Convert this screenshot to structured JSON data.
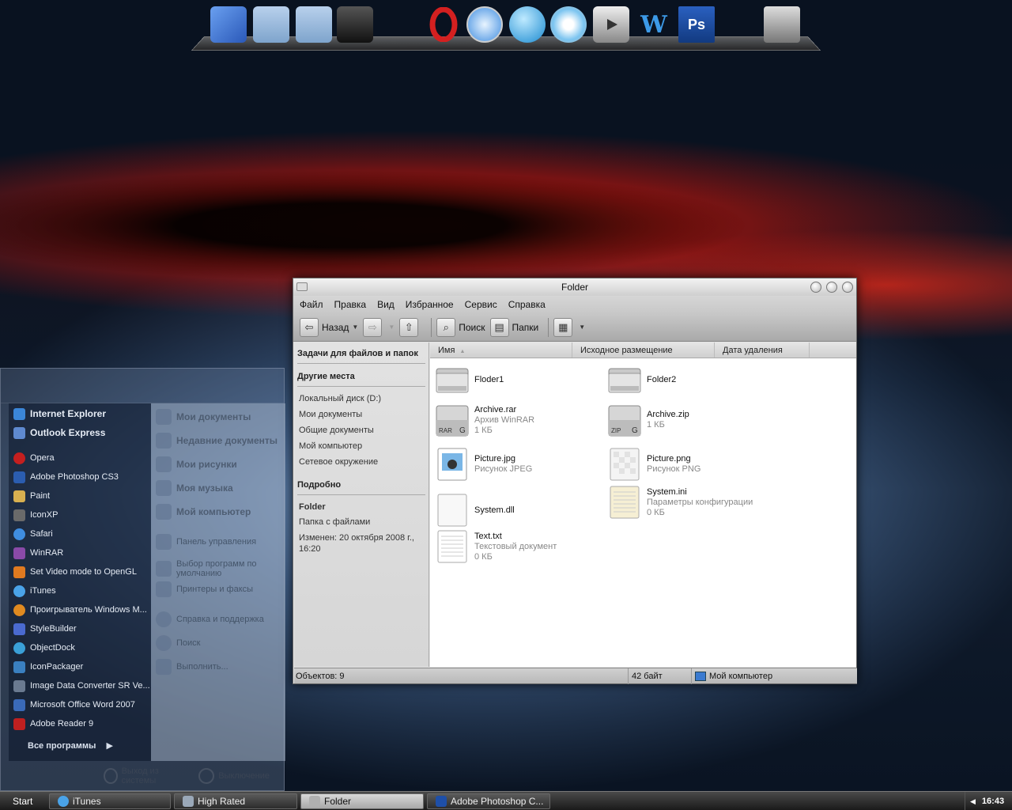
{
  "dock": {
    "icons": [
      {
        "name": "finder-icon",
        "color": "#3a6fd0"
      },
      {
        "name": "documents-folder-icon",
        "color": "#8ab0d8"
      },
      {
        "name": "downloads-folder-icon",
        "color": "#8ab0d8"
      },
      {
        "name": "camera-icon",
        "color": "#222222"
      },
      {
        "name": "opera-icon",
        "color": "#c41f1f"
      },
      {
        "name": "safari-icon",
        "color": "#3f8de0"
      },
      {
        "name": "internet-globe-icon",
        "color": "#2aa0e0"
      },
      {
        "name": "itunes-icon",
        "color": "#4aa3e8"
      },
      {
        "name": "media-player-icon",
        "color": "#9a9a9a"
      },
      {
        "name": "word-icon",
        "color": "#3c8fe0"
      },
      {
        "name": "photoshop-icon",
        "color": "#1e4fa8",
        "label": "Ps"
      },
      {
        "name": "system-preferences-icon",
        "color": "#8a8a8a"
      }
    ]
  },
  "start_menu": {
    "pinned": [
      {
        "label": "Internet Explorer",
        "color": "#3b86d8"
      },
      {
        "label": "Outlook Express",
        "color": "#5f8ad0"
      }
    ],
    "recent": [
      {
        "label": "Opera",
        "color": "#c41f1f"
      },
      {
        "label": "Adobe Photoshop CS3",
        "color": "#2b5db0"
      },
      {
        "label": "Paint",
        "color": "#d8b050"
      },
      {
        "label": "IconXP",
        "color": "#6a6a6a"
      },
      {
        "label": "Safari",
        "color": "#3f8de0"
      },
      {
        "label": "WinRAR",
        "color": "#8a4aa8"
      },
      {
        "label": "Set Video mode to OpenGL",
        "color": "#e07a20"
      },
      {
        "label": "iTunes",
        "color": "#4aa3e8"
      },
      {
        "label": "Проигрыватель Windows M...",
        "color": "#e08a20"
      },
      {
        "label": "StyleBuilder",
        "color": "#4a6ad0"
      },
      {
        "label": "ObjectDock",
        "color": "#3aa0d8"
      },
      {
        "label": "IconPackager",
        "color": "#3a80c0"
      },
      {
        "label": "Image Data Converter SR Ve...",
        "color": "#6a7a90"
      },
      {
        "label": "Microsoft Office Word 2007",
        "color": "#3a6ab8"
      },
      {
        "label": "Adobe Reader 9",
        "color": "#c02020"
      }
    ],
    "all_programs": "Все программы",
    "places_main": [
      "Мои документы",
      "Недавние документы",
      "Мои рисунки",
      "Моя музыка",
      "Мой компьютер"
    ],
    "places_sys": [
      "Панель управления",
      "Выбор программ по умолчанию",
      "Принтеры и факсы",
      "Справка и поддержка",
      "Поиск",
      "Выполнить..."
    ],
    "logoff": "Выход из системы",
    "shutdown": "Выключение"
  },
  "window": {
    "title": "Folder",
    "menu": [
      "Файл",
      "Правка",
      "Вид",
      "Избранное",
      "Сервис",
      "Справка"
    ],
    "toolbar": {
      "back": "Назад",
      "search": "Поиск",
      "folders": "Папки"
    },
    "left_pane": {
      "tasks_header": "Задачи для файлов и папок",
      "places_header": "Другие места",
      "places": [
        "Локальный диск (D:)",
        "Мои документы",
        "Общие документы",
        "Мой компьютер",
        "Сетевое окружение"
      ],
      "details_header": "Подробно",
      "details_name": "Folder",
      "details_type": "Папка с файлами",
      "details_modified": "Изменен: 20 октября 2008 г., 16:20"
    },
    "columns": [
      "Имя",
      "Исходное размещение",
      "Дата удаления"
    ],
    "files": [
      {
        "name": "Floder1",
        "desc": "",
        "size": "",
        "icon": "folder-icon"
      },
      {
        "name": "Folder2",
        "desc": "",
        "size": "",
        "icon": "folder-icon"
      },
      {
        "name": "Archive.rar",
        "desc": "Архив WinRAR",
        "size": "1 КБ",
        "icon": "rar-archive-icon"
      },
      {
        "name": "Archive.zip",
        "desc": "",
        "size": "1 КБ",
        "icon": "zip-archive-icon"
      },
      {
        "name": "Picture.jpg",
        "desc": "Рисунок JPEG",
        "size": "",
        "icon": "jpeg-image-icon"
      },
      {
        "name": "Picture.png",
        "desc": "Рисунок PNG",
        "size": "",
        "icon": "png-image-icon"
      },
      {
        "name": "System.dll",
        "desc": "",
        "size": "",
        "icon": "dll-file-icon"
      },
      {
        "name": "System.ini",
        "desc": "Параметры конфигурации",
        "size": "0 КБ",
        "icon": "ini-file-icon"
      },
      {
        "name": "Text.txt",
        "desc": "Текстовый документ",
        "size": "0 КБ",
        "icon": "text-file-icon"
      }
    ],
    "status": {
      "objects": "Объектов: 9",
      "size": "42 байт",
      "location": "Мой компьютер"
    }
  },
  "taskbar": {
    "start": "Start",
    "tasks": [
      {
        "label": "iTunes",
        "color": "#4aa3e8",
        "active": false
      },
      {
        "label": "High Rated",
        "color": "#9aa8b8",
        "active": false
      },
      {
        "label": "Folder",
        "color": "#b0b0b0",
        "active": true
      },
      {
        "label": "Adobe Photoshop C...",
        "color": "#1e4fa8",
        "active": false
      }
    ],
    "clock": "16:43"
  }
}
